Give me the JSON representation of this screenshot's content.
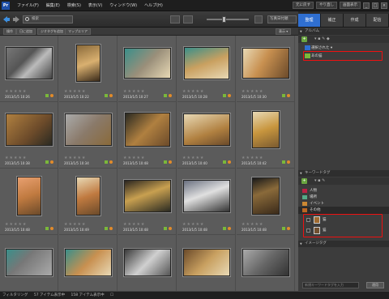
{
  "menubar": {
    "logo": "Pr",
    "menus": [
      "ファイル(F)",
      "編集(E)",
      "検索(S)",
      "表示(V)",
      "ウィンドウ(W)",
      "ヘルプ(H)"
    ],
    "undo": "元に戻す",
    "redo": "やり直し",
    "display": "画面表示",
    "window_buttons": [
      "_",
      "□",
      "×"
    ]
  },
  "toolbar": {
    "search_label": "検索",
    "view_select": "写真日付順"
  },
  "right_tabs": [
    {
      "label": "整理",
      "active": true
    },
    {
      "label": "補正",
      "active": false
    },
    {
      "label": "作成",
      "active": false
    },
    {
      "label": "配信",
      "active": false
    }
  ],
  "subbar": {
    "buttons": [
      "操作",
      "日に追加",
      "ジオタグを追加",
      "マップエリア"
    ],
    "right_button": "表示 ▾"
  },
  "grid": {
    "stars": "★★★★★",
    "dates": [
      "2013/1/5 10:26",
      "2013/1/5 10:22",
      "2013/1/5 10:27",
      "2013/1/5 10:28",
      "2013/1/5 10:30",
      "2013/1/5 10:38",
      "2013/1/5 10:34",
      "2013/1/5 10:48",
      "2013/1/5 10:40",
      "2013/1/5 10:42",
      "2013/1/5 10:48",
      "2013/1/5 10:49",
      "2013/1/5 10:48",
      "2013/1/5 10:48",
      "2013/1/5 10:48",
      "",
      "",
      "",
      "",
      ""
    ],
    "colors": {
      "cat": "#8a6a3a",
      "cream": "#e8d9b5",
      "teal": "#3a8f8a",
      "dark": "#2a2a22"
    }
  },
  "statusbar": {
    "items": [
      "フィルタリング",
      "57 アイテム表示中",
      "158 アイテム表示中",
      "☐"
    ]
  },
  "panel": {
    "albums_header": "アルバム",
    "album_items": [
      "選択された ▾",
      "あの猫"
    ],
    "keywords_header": "キーワードタグ",
    "tag_rows": [
      "人物",
      "場所",
      "イベント",
      "その他"
    ],
    "tag_sub": [
      "猫",
      "猫"
    ],
    "other_header": "イメージタグ",
    "search_placeholder": "新規キーワードタグを入力",
    "apply_button": "適用"
  }
}
